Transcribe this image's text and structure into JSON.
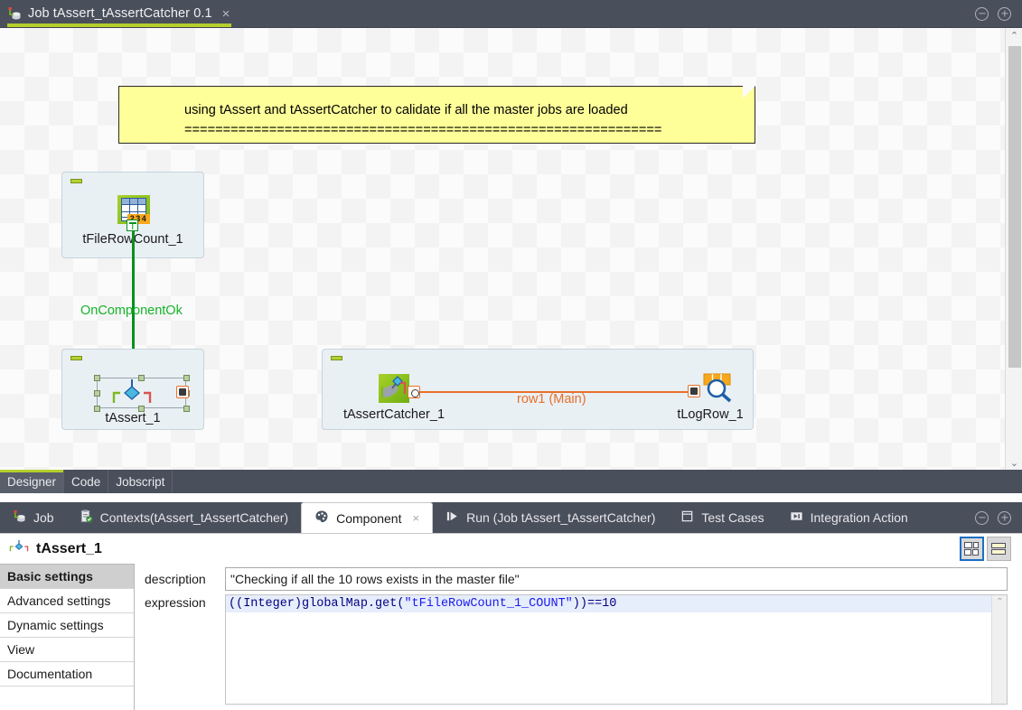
{
  "titlebar": {
    "tab_title": "Job tAssert_tAssertCatcher 0.1",
    "close_glyph": "×",
    "job_icon": "job-icon",
    "minimize_icon": "minimize-icon",
    "maximize_icon": "maximize-icon"
  },
  "canvas": {
    "note": {
      "line1": "using tAssert and tAssertCatcher to calidate if all the master jobs are loaded",
      "line2": "=============================================================="
    },
    "components": [
      {
        "name": "tFileRowCount_1",
        "icon": "file-row-count-icon",
        "grid_numbers": "234"
      },
      {
        "name": "tAssert_1",
        "icon": "assert-icon",
        "selected": true
      },
      {
        "name": "tAssertCatcher_1",
        "icon": "assert-catcher-icon"
      },
      {
        "name": "tLogRow_1",
        "icon": "log-row-icon"
      }
    ],
    "connections": [
      {
        "label": "OnComponentOk",
        "color": "#17b32b",
        "from": "tFileRowCount_1",
        "to": "tAssert_1"
      },
      {
        "label": "row1 (Main)",
        "color": "#e8702a",
        "from": "tAssertCatcher_1",
        "to": "tLogRow_1"
      }
    ],
    "scrollbar": {
      "up_glyph": "⌃",
      "down_glyph": "⌄"
    }
  },
  "editor_tabs": [
    {
      "label": "Designer",
      "active": true
    },
    {
      "label": "Code",
      "active": false
    },
    {
      "label": "Jobscript",
      "active": false
    }
  ],
  "view_tabs": [
    {
      "label": "Job",
      "icon": "job-icon",
      "active": false
    },
    {
      "label": "Contexts(tAssert_tAssertCatcher)",
      "icon": "contexts-icon",
      "active": false
    },
    {
      "label": "Component",
      "icon": "component-palette-icon",
      "active": true,
      "close_glyph": "×"
    },
    {
      "label": "Run (Job tAssert_tAssertCatcher)",
      "icon": "run-icon",
      "active": false
    },
    {
      "label": "Test Cases",
      "icon": "test-cases-icon",
      "active": false
    },
    {
      "label": "Integration Action",
      "icon": "integration-action-icon",
      "active": false
    }
  ],
  "view_controls": {
    "minimize_icon": "minimize-icon",
    "maximize_icon": "maximize-icon"
  },
  "properties": {
    "title": "tAssert_1",
    "title_icon": "assert-icon",
    "layout_buttons": [
      {
        "name": "grid-layout-button",
        "active": true
      },
      {
        "name": "list-layout-button",
        "active": false
      }
    ],
    "settings_tabs": [
      {
        "label": "Basic settings",
        "active": true
      },
      {
        "label": "Advanced settings",
        "active": false
      },
      {
        "label": "Dynamic settings",
        "active": false
      },
      {
        "label": "View",
        "active": false
      },
      {
        "label": "Documentation",
        "active": false
      }
    ],
    "fields": {
      "description_label": "description",
      "description_value": "\"Checking if all the 10 rows exists in the master file\"",
      "expression_label": "expression",
      "expression_prefix": "((Integer)globalMap.get(",
      "expression_string": "\"tFileRowCount_1_COUNT\"",
      "expression_suffix": "))==10"
    },
    "scroll_up_glyph": "⌃"
  },
  "colors": {
    "chrome_dark": "#4a4f5c",
    "accent_green": "#b4cf2c",
    "connection_green": "#17b32b",
    "connection_orange": "#e8702a",
    "note_yellow": "#ffff99",
    "selection_blue": "#1b6fc4"
  }
}
